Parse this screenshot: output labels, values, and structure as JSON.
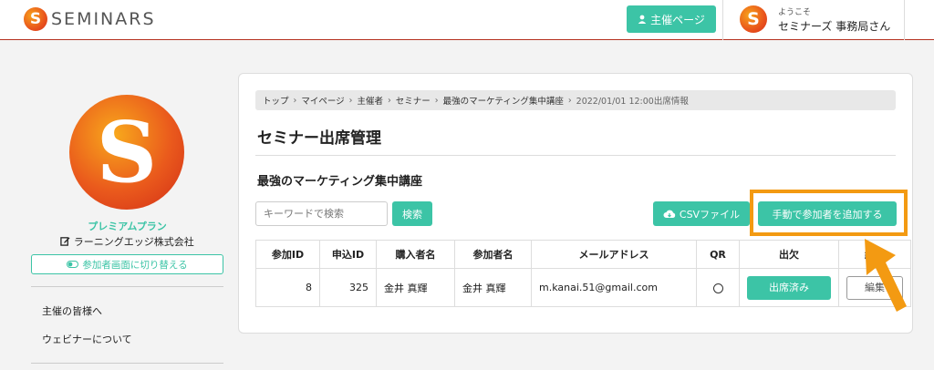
{
  "header": {
    "logo_letter": "S",
    "logo_text": "SEMINARS",
    "host_page_label": "主催ページ",
    "welcome_label": "ようこそ",
    "username": "セミナーズ 事務局さん",
    "avatar_letter": "S"
  },
  "sidebar": {
    "avatar_letter": "S",
    "plan": "プレミアムプラン",
    "company": "ラーニングエッジ株式会社",
    "switch_label": "参加者画面に切り替える",
    "links": [
      "主催の皆様へ",
      "ウェビナーについて"
    ]
  },
  "breadcrumb": [
    "トップ",
    "マイページ",
    "主催者",
    "セミナー",
    "最強のマーケティング集中講座",
    "2022/01/01 12:00出席情報"
  ],
  "page_title": "セミナー出席管理",
  "seminar_name": "最強のマーケティング集中講座",
  "search": {
    "placeholder": "キーワードで検索",
    "button": "検索"
  },
  "csv_label": "CSVファイル",
  "add_participant_label": "手動で参加者を追加する",
  "table": {
    "headers": [
      "参加ID",
      "申込ID",
      "購入者名",
      "参加者名",
      "メールアドレス",
      "QR",
      "出欠",
      "編集"
    ],
    "rows": [
      {
        "participant_id": "8",
        "application_id": "325",
        "buyer": "金井 真輝",
        "participant": "金井 真輝",
        "email": "m.kanai.51@gmail.com",
        "qr": "○",
        "attendance": "出席済み",
        "edit": "編集"
      }
    ]
  },
  "colors": {
    "accent": "#3cc4a6",
    "highlight": "#f39a12",
    "header_border": "#b5311f"
  }
}
